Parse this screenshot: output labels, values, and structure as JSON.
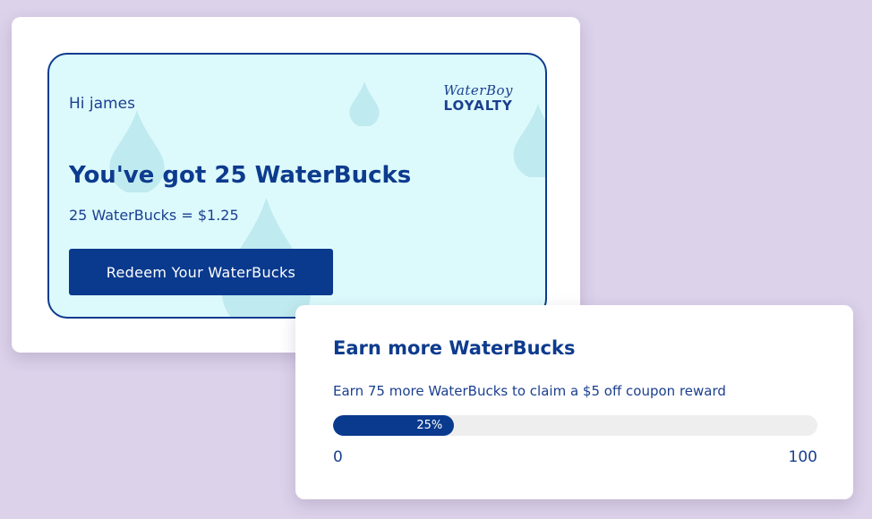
{
  "colors": {
    "background": "#dcd2ea",
    "panel": "#dcfafc",
    "primary": "#0a3a8e",
    "text": "#1b3f8f",
    "track": "#eeeeee"
  },
  "loyalty_card": {
    "greeting": "Hi james",
    "brand": {
      "script": "WaterBoy",
      "word": "LOYALTY"
    },
    "headline": "You've got 25 WaterBucks",
    "conversion": "25 WaterBucks = $1.25",
    "redeem_label": "Redeem Your WaterBucks"
  },
  "earn_card": {
    "title": "Earn more WaterBucks",
    "description": "Earn 75 more WaterBucks to claim a $5 off coupon reward",
    "progress": {
      "value": 0.25,
      "label": "25%",
      "min": "0",
      "max": "100"
    }
  },
  "decorations": {
    "icon": "water-drop-icon"
  }
}
